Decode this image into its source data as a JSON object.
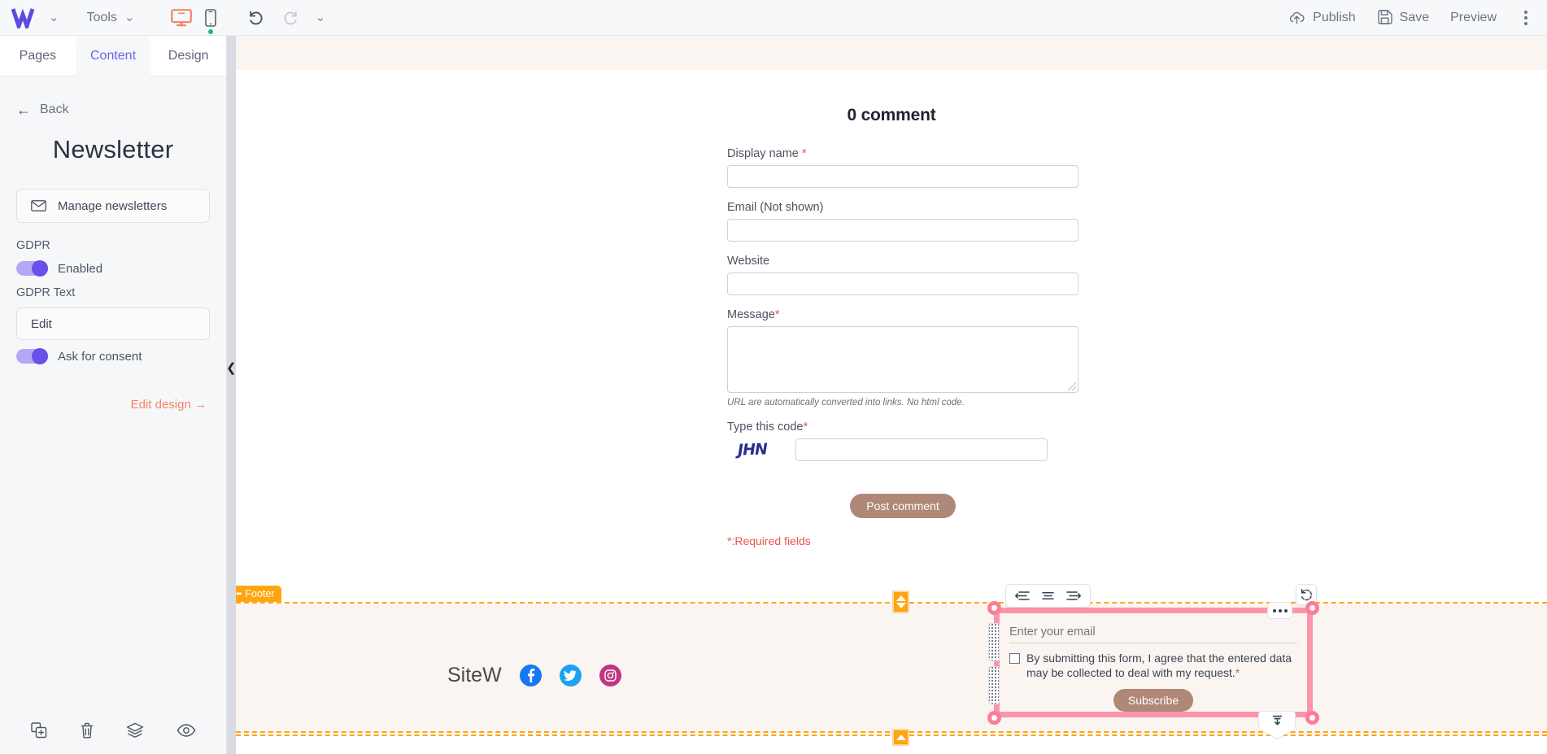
{
  "topbar": {
    "logo_alt": "SiteW logo",
    "tools_label": "Tools",
    "publish_label": "Publish",
    "save_label": "Save",
    "preview_label": "Preview",
    "desktop_icon": "monitor-icon",
    "mobile_icon": "mobile-icon",
    "undo_icon": "undo-icon",
    "redo_icon": "redo-icon",
    "accent_orange": "#f4836a",
    "status_dot_color": "#0ec26a"
  },
  "sidebar": {
    "tabs": [
      {
        "label": "Pages",
        "active": false
      },
      {
        "label": "Content",
        "active": true
      },
      {
        "label": "Design",
        "active": false
      }
    ],
    "back_label": "Back",
    "title": "Newsletter",
    "manage_button": "Manage newsletters",
    "gdpr_section_label": "GDPR",
    "enabled_toggle_label": "Enabled",
    "enabled_toggle_on": true,
    "gdpr_text_label": "GDPR Text",
    "edit_button": "Edit",
    "consent_toggle_label": "Ask for consent",
    "consent_toggle_on": true,
    "edit_design_label": "Edit design",
    "bottom_tools": [
      "duplicate-icon",
      "trash-icon",
      "layers-icon",
      "eye-icon"
    ],
    "accent_purple": "#6c63e8"
  },
  "comment_form": {
    "heading": "0 comment",
    "fields": [
      {
        "label": "Display name",
        "required": true,
        "value": ""
      },
      {
        "label": "Email (Not shown)",
        "required": false,
        "value": ""
      },
      {
        "label": "Website",
        "required": false,
        "value": ""
      }
    ],
    "message_label": "Message",
    "message_required": true,
    "message_value": "",
    "url_note": "URL are automatically converted into links. No html code.",
    "captcha_label": "Type this code",
    "captcha_required": true,
    "captcha_code": "JHN",
    "captcha_value": "",
    "post_button": "Post comment",
    "required_note": "*:Required fields",
    "button_color": "#b08878"
  },
  "footer": {
    "tag_label": "Footer",
    "tag_color": "#ffa510",
    "brand": "SiteW",
    "socials": [
      {
        "name": "facebook-icon",
        "color": "#1877f2"
      },
      {
        "name": "twitter-icon",
        "color": "#1da1f2"
      },
      {
        "name": "instagram-icon",
        "color": "#c13584"
      }
    ]
  },
  "newsletter_widget": {
    "align_buttons": [
      "align-left-icon",
      "align-center-icon",
      "align-right-icon"
    ],
    "rotate_icon": "rotate-icon",
    "more_icon": "more-options-icon",
    "bottom_align_icon": "align-bottom-icon",
    "email_placeholder": "Enter your email",
    "email_value": "",
    "consent_text": "By submitting this form, I agree that the entered data may be collected to deal with my request.",
    "consent_required_mark": "*",
    "consent_checked": false,
    "subscribe_button": "Subscribe",
    "selection_color": "#fb7e95",
    "button_color": "#b08878"
  }
}
